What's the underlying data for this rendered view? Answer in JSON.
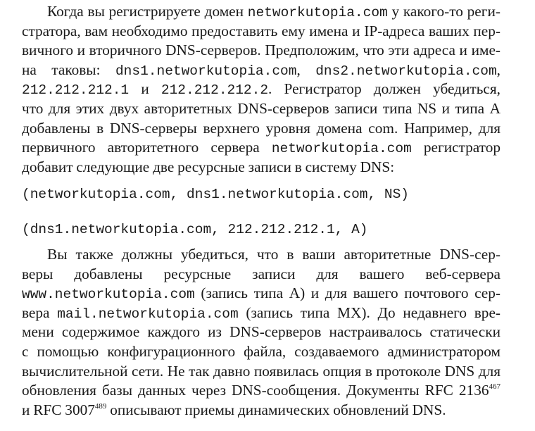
{
  "paragraph1": {
    "lines": [
      [
        {
          "t": "Когда вы регистрируете домен "
        },
        {
          "m": "networkutopia.com"
        },
        {
          "t": " у какого-то реги-"
        }
      ],
      [
        {
          "t": "стратора, вам необходимо предоставить ему имена и IP-адреса ваших пер-"
        }
      ],
      [
        {
          "t": "вичного и вторичного DNS-серверов. Предположим, что эти адреса и име-"
        }
      ],
      [
        {
          "t": "на таковы: "
        },
        {
          "m": "dns1.networkutopia.com"
        },
        {
          "t": ", "
        },
        {
          "m": "dns2.networkutopia.com"
        },
        {
          "t": ","
        }
      ],
      [
        {
          "m": "212.212.212.1"
        },
        {
          "t": " и "
        },
        {
          "m": "212.212.212.2"
        },
        {
          "t": ". Регистратор должен убедиться,"
        }
      ],
      [
        {
          "t": "что для этих двух авторитетных DNS-серверов записи типа NS и типа A"
        }
      ],
      [
        {
          "t": "добавлены в DNS-серверы верхнего уровня домена com. Например, для"
        }
      ],
      [
        {
          "t": "первичного авторитетного сервера "
        },
        {
          "m": "networkutopia.com"
        },
        {
          "t": " регистратор"
        }
      ],
      [
        {
          "t": "добавит следующие две ресурсные записи в систему DNS:"
        }
      ]
    ]
  },
  "code": {
    "record1": "(networkutopia.com, dns1.networkutopia.com, NS)",
    "record2": "(dns1.networkutopia.com, 212.212.212.1, A)"
  },
  "paragraph2": {
    "lines": [
      [
        {
          "t": "Вы также должны убедиться, что в ваши авторитетные DNS-сер-"
        }
      ],
      [
        {
          "t": "веры добавлены ресурсные записи для вашего веб-сервера"
        }
      ],
      [
        {
          "m": "www.networkutopia.com"
        },
        {
          "t": " (запись типа A) и для вашего почтового сер-"
        }
      ],
      [
        {
          "t": "вера "
        },
        {
          "m": "mail.networkutopia.com"
        },
        {
          "t": " (запись типа MX). До недавнего вре-"
        }
      ],
      [
        {
          "t": "мени содержимое каждого из DNS-серверов настраивалось статически"
        }
      ],
      [
        {
          "t": "с помощью конфигурационного файла, создаваемого администратором"
        }
      ],
      [
        {
          "t": "вычислительной сети. Не так давно появилась опция в протоколе DNS для"
        }
      ],
      [
        {
          "t": "обновления базы данных через DNS-сообщения. Документы RFC 2136"
        },
        {
          "s": "467"
        }
      ],
      [
        {
          "t": "и RFC 3007"
        },
        {
          "s": "489"
        },
        {
          "t": " описывают приемы динамических обновлений DNS."
        }
      ]
    ]
  }
}
